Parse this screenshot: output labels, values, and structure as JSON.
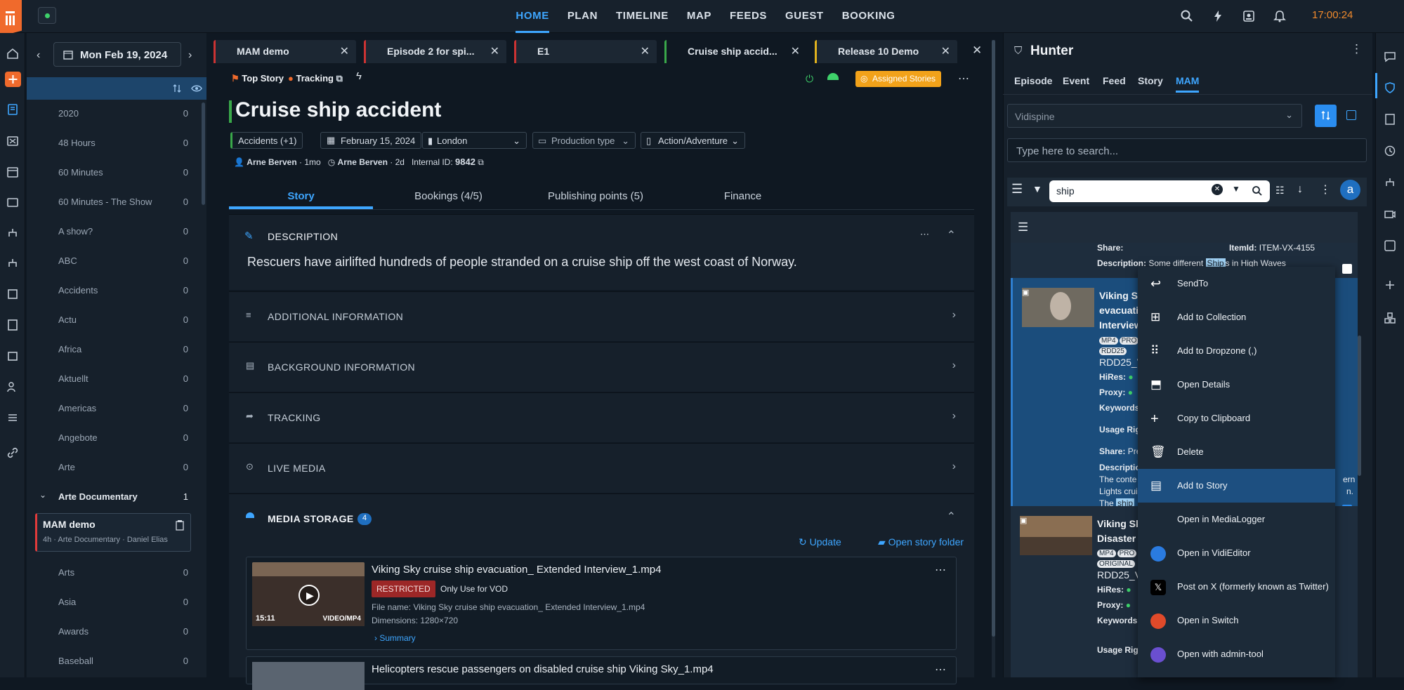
{
  "app": {
    "clock": "17:00:24",
    "nav": [
      "HOME",
      "PLAN",
      "TIMELINE",
      "MAP",
      "FEEDS",
      "GUEST",
      "BOOKING"
    ],
    "active_nav": "HOME"
  },
  "sidebar": {
    "date": "Mon Feb 19, 2024",
    "items": [
      {
        "label": "2020",
        "count": "0"
      },
      {
        "label": "48 Hours",
        "count": "0"
      },
      {
        "label": "60 Minutes",
        "count": "0"
      },
      {
        "label": "60 Minutes - The Show",
        "count": "0"
      },
      {
        "label": "A show?",
        "count": "0"
      },
      {
        "label": "ABC",
        "count": "0"
      },
      {
        "label": "Accidents",
        "count": "0"
      },
      {
        "label": "Actu",
        "count": "0"
      },
      {
        "label": "Africa",
        "count": "0"
      },
      {
        "label": "Aktuellt",
        "count": "0"
      },
      {
        "label": "Americas",
        "count": "0"
      },
      {
        "label": "Angebote",
        "count": "0"
      },
      {
        "label": "Arte",
        "count": "0"
      }
    ],
    "group": {
      "label": "Arte Documentary",
      "count": "1"
    },
    "card": {
      "title": "MAM demo",
      "meta": "4h · Arte Documentary · Daniel Elias"
    },
    "items2": [
      {
        "label": "Arts",
        "count": "0"
      },
      {
        "label": "Asia",
        "count": "0"
      },
      {
        "label": "Awards",
        "count": "0"
      },
      {
        "label": "Baseball",
        "count": "0"
      }
    ]
  },
  "tabs": [
    "MAM demo",
    "Episode 2 for spi...",
    "E1",
    "Cruise ship accid...",
    "Release 10 Demo"
  ],
  "tab_colors": [
    "#e23b3b",
    "#e23b3b",
    "#e23b3b",
    "#3aa84a",
    "#e0b21e"
  ],
  "story": {
    "flag": "Top Story",
    "tracking": "Tracking",
    "assigned": "Assigned Stories",
    "title": "Cruise ship accident",
    "chips": {
      "category": "Accidents (+1)",
      "date": "February 15, 2024",
      "location": "London",
      "production": "Production type",
      "genre": "Action/Adventure"
    },
    "author1": "Arne Berven",
    "age1": "1mo",
    "author2": "Arne Berven",
    "age2": "2d",
    "internal_label": "Internal ID:",
    "internal_id": "9842",
    "tabs": [
      "Story",
      "Bookings (4/5)",
      "Publishing points (5)",
      "Finance"
    ],
    "sections": {
      "description": "DESCRIPTION",
      "additional": "ADDITIONAL INFORMATION",
      "background": "BACKGROUND INFORMATION",
      "tracking": "TRACKING",
      "live": "LIVE MEDIA",
      "media": "MEDIA STORAGE"
    },
    "description_text": "Rescuers have airlifted hundreds of people stranded on a cruise ship off the west coast of Norway.",
    "media_count": "4",
    "update": "Update",
    "open_folder": "Open story folder",
    "media": [
      {
        "title": "Viking Sky cruise ship evacuation_ Extended Interview_1.mp4",
        "badge": "RESTRICTED",
        "note": "Only Use for VOD",
        "filename": "File name: Viking Sky cruise ship evacuation_ Extended Interview_1.mp4",
        "dims": "Dimensions: 1280×720",
        "duration": "15:11",
        "format": "VIDEO/MP4",
        "summary": "Summary"
      },
      {
        "title": "Helicopters rescue passengers on disabled cruise ship Viking Sky_1.mp4"
      }
    ]
  },
  "hunter": {
    "title": "Hunter",
    "tabs": [
      "Episode",
      "Event",
      "Feed",
      "Story",
      "MAM"
    ],
    "active_tab": "MAM",
    "source": "Vidispine",
    "search_placeholder": "Type here to search...",
    "query": "ship",
    "avatar": "a",
    "top": {
      "share": "Share:",
      "itemid_label": "ItemId:",
      "itemid": "ITEM-VX-4155",
      "desc_label": "Description:",
      "desc_text": "Some different",
      "desc_hl": "Ship",
      "desc_rest": "s in High Waves"
    },
    "r1": {
      "title": [
        "Viking Sk",
        "evacuatio",
        "Interview"
      ],
      "tags": [
        "MP4",
        "PRO",
        "RDD25"
      ],
      "code": "RDD25_V",
      "hires": "HiRes:",
      "proxy": "Proxy:",
      "keywords": "Keywords",
      "usage": "Usage Rig",
      "share": "Share:",
      "share_v": "Pre",
      "desc": "Description",
      "d1": "The conte",
      "d1b": "ern",
      "d2": "Lights crui",
      "d2b": "n.",
      "d3": "The",
      "d3hl": "ship"
    },
    "r2": {
      "title": [
        "Viking Sk",
        "Disaster"
      ],
      "tags": [
        "MP4",
        "PRO",
        "ORIGINAL"
      ],
      "code": "RDD25_V",
      "hires": "HiRes:",
      "proxy": "Proxy:",
      "keywords": "Keywords",
      "usage": "Usage Rig"
    }
  },
  "context_menu": [
    "SendTo",
    "Add to Collection",
    "Add to Dropzone (,)",
    "Open Details",
    "Copy to Clipboard",
    "Delete",
    "Add to Story",
    "Open in MediaLogger",
    "Open in VidiEditor",
    "Post on X (formerly known as Twitter)",
    "Open in Switch",
    "Open with admin-tool"
  ],
  "context_highlight": "Add to Story"
}
